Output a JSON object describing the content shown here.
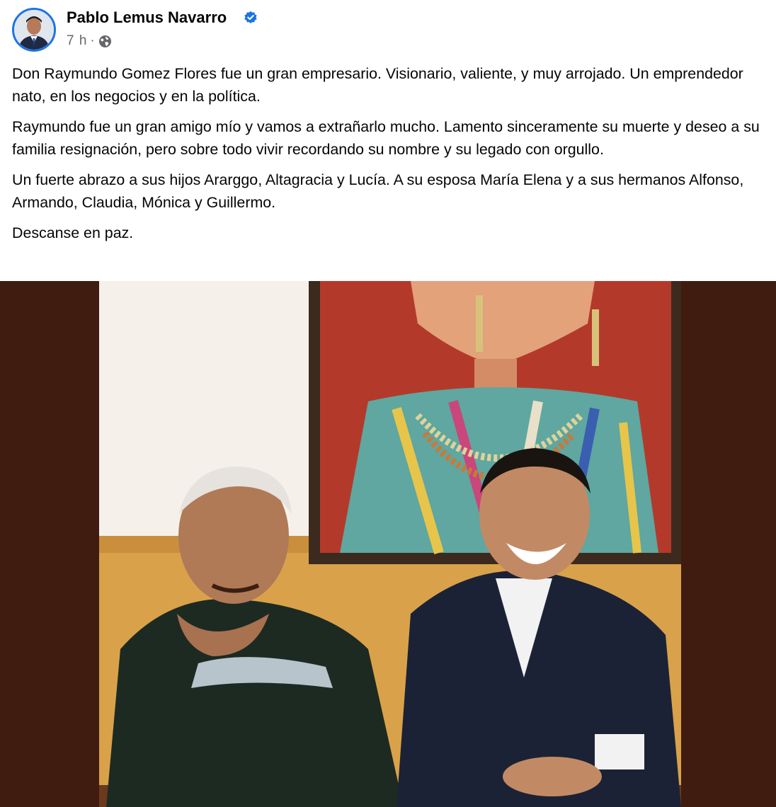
{
  "post": {
    "author": "Pablo Lemus Navarro",
    "verified": true,
    "time": "7 h",
    "separator": "·",
    "audience_icon": "globe-icon",
    "paragraphs": [
      "Don Raymundo Gomez Flores fue un gran empresario. Visionario, valiente, y muy arrojado. Un emprendedor nato, en los negocios y en la política.",
      "Raymundo fue un gran amigo mío y vamos a extrañarlo mucho. Lamento sinceramente su muerte y deseo a su familia resignación, pero sobre todo vivir recordando su nombre y su legado con orgullo.",
      "Un fuerte abrazo a sus hijos Ararggo, Altagracia y Lucía. A su esposa María Elena y a sus hermanos Alfonso, Armando, Claudia, Mónica y Guillermo.",
      "Descanse en paz."
    ]
  },
  "colors": {
    "verified_blue": "#1b74e4",
    "meta_gray": "#65676b",
    "photo_backdrop": "#401c10"
  }
}
